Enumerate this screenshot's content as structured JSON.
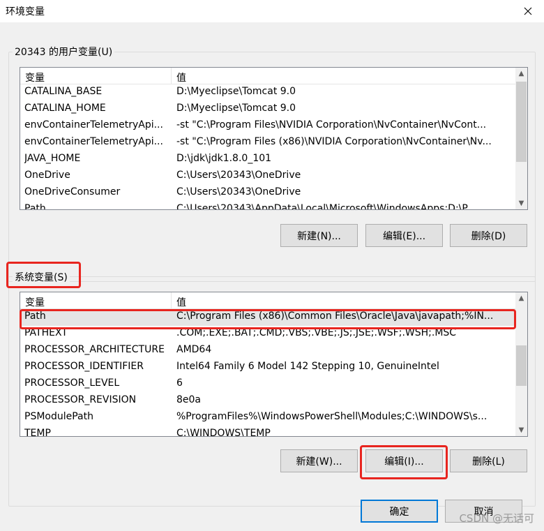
{
  "window": {
    "title": "环境变量"
  },
  "user_vars": {
    "group_label": "20343 的用户变量(U)",
    "columns": [
      "变量",
      "值"
    ],
    "rows": [
      [
        "CATALINA_BASE",
        "D:\\Myeclipse\\Tomcat 9.0"
      ],
      [
        "CATALINA_HOME",
        "D:\\Myeclipse\\Tomcat 9.0"
      ],
      [
        "envContainerTelemetryApi...",
        "-st \"C:\\Program Files\\NVIDIA Corporation\\NvContainer\\NvCont..."
      ],
      [
        "envContainerTelemetryApi...",
        "-st \"C:\\Program Files (x86)\\NVIDIA Corporation\\NvContainer\\Nv..."
      ],
      [
        "JAVA_HOME",
        "D:\\jdk\\jdk1.8.0_101"
      ],
      [
        "OneDrive",
        "C:\\Users\\20343\\OneDrive"
      ],
      [
        "OneDriveConsumer",
        "C:\\Users\\20343\\OneDrive"
      ],
      [
        "Path",
        "C:\\Users\\20343\\AppData\\Local\\Microsoft\\WindowsApps;D:\\P..."
      ]
    ],
    "buttons": {
      "new": "新建(N)...",
      "edit": "编辑(E)...",
      "delete": "删除(D)"
    }
  },
  "system_vars": {
    "group_label": "系统变量(S)",
    "columns": [
      "变量",
      "值"
    ],
    "rows": [
      [
        "Path",
        "C:\\Program Files (x86)\\Common Files\\Oracle\\Java\\javapath;%IN..."
      ],
      [
        "PATHEXT",
        ".COM;.EXE;.BAT;.CMD;.VBS;.VBE;.JS;.JSE;.WSF;.WSH;.MSC"
      ],
      [
        "PROCESSOR_ARCHITECTURE",
        "AMD64"
      ],
      [
        "PROCESSOR_IDENTIFIER",
        "Intel64 Family 6 Model 142 Stepping 10, GenuineIntel"
      ],
      [
        "PROCESSOR_LEVEL",
        "6"
      ],
      [
        "PROCESSOR_REVISION",
        "8e0a"
      ],
      [
        "PSModulePath",
        "%ProgramFiles%\\WindowsPowerShell\\Modules;C:\\WINDOWS\\s..."
      ],
      [
        "TEMP",
        "C:\\WINDOWS\\TEMP"
      ]
    ],
    "buttons": {
      "new": "新建(W)...",
      "edit": "编辑(I)...",
      "delete": "删除(L)"
    }
  },
  "footer": {
    "ok": "确定",
    "cancel": "取消"
  },
  "watermark": "CSDN @无话可",
  "icons": {
    "close": "close-icon",
    "scroll_up": "chevron-up-icon",
    "scroll_down": "chevron-down-icon"
  },
  "colors": {
    "highlight": "#e8251f",
    "accent": "#0078d7"
  }
}
